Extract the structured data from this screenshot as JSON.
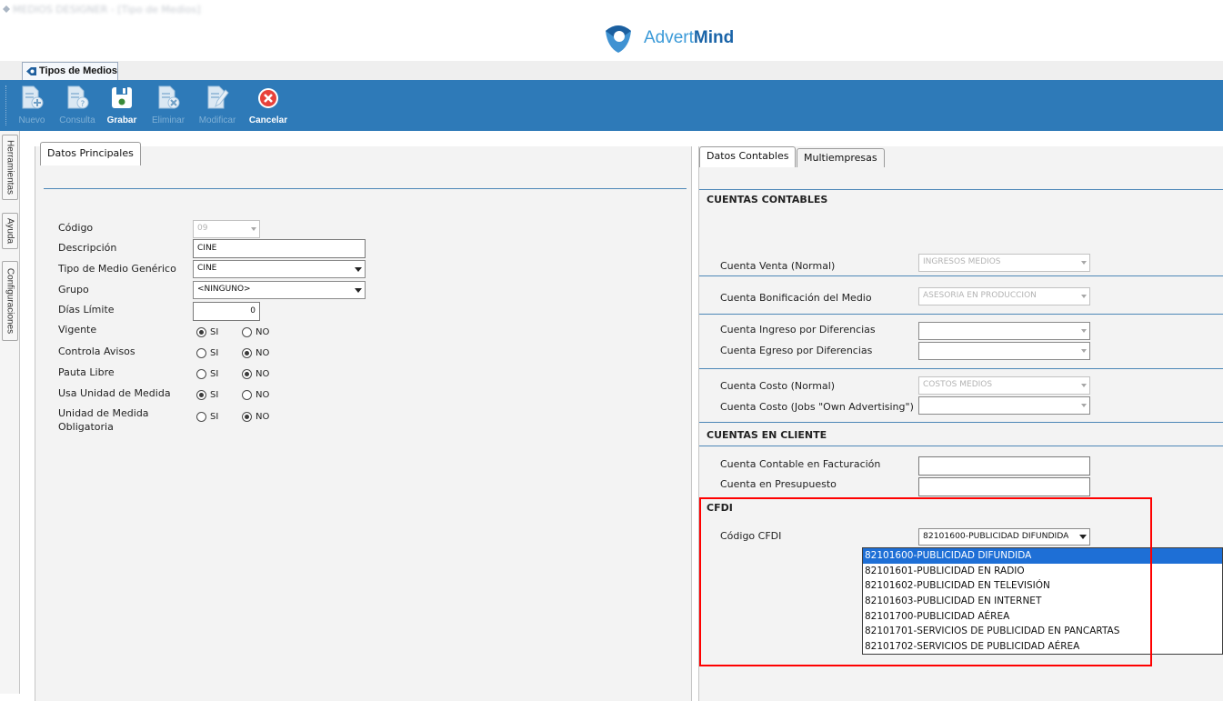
{
  "brand": {
    "prefix": "Advert",
    "strong": "Mind"
  },
  "doc_tab": {
    "label": "Tipos de Medios"
  },
  "toolbar": {
    "buttons": [
      {
        "id": "nuevo",
        "label": "Nuevo",
        "enabled": false,
        "icon": "new-document-icon"
      },
      {
        "id": "consulta",
        "label": "Consulta",
        "enabled": false,
        "icon": "query-document-icon"
      },
      {
        "id": "grabar",
        "label": "Grabar",
        "enabled": true,
        "icon": "save-icon"
      },
      {
        "id": "eliminar",
        "label": "Eliminar",
        "enabled": false,
        "icon": "delete-document-icon"
      },
      {
        "id": "modificar",
        "label": "Modificar",
        "enabled": false,
        "icon": "edit-document-icon"
      },
      {
        "id": "cancelar",
        "label": "Cancelar",
        "enabled": true,
        "icon": "cancel-icon"
      }
    ]
  },
  "side_tabs": [
    "Herramientas",
    "Ayuda",
    "Configuraciones"
  ],
  "left": {
    "tab": "Datos Principales",
    "fields": {
      "codigo": {
        "label": "Código",
        "value": "09"
      },
      "descripcion": {
        "label": "Descripción",
        "value": "CINE"
      },
      "tipo_generico": {
        "label": "Tipo de Medio Genérico",
        "value": "CINE"
      },
      "grupo": {
        "label": "Grupo",
        "value": "<NINGUNO>"
      },
      "dias_limite": {
        "label": "Días Límite",
        "value": "0"
      },
      "vigente": {
        "label": "Vigente",
        "value": "SI"
      },
      "controla_avisos": {
        "label": "Controla Avisos",
        "value": "NO"
      },
      "pauta_libre": {
        "label": "Pauta Libre",
        "value": "NO"
      },
      "usa_unidad": {
        "label": "Usa Unidad de Medida",
        "value": "SI"
      },
      "unidad_obligatoria": {
        "label_1": "Unidad de Medida",
        "label_2": "Obligatoria",
        "value": "NO"
      }
    },
    "radio_si": "SI",
    "radio_no": "NO"
  },
  "right": {
    "tabs": [
      "Datos Contables",
      "Multiempresas"
    ],
    "cuentas_contables": {
      "title": "CUENTAS CONTABLES",
      "venta_normal": {
        "label": "Cuenta Venta (Normal)",
        "value": "INGRESOS MEDIOS"
      },
      "bonificacion": {
        "label": "Cuenta Bonificación del Medio",
        "value": "ASESORIA EN PRODUCCION"
      },
      "ingreso_dif": {
        "label": "Cuenta Ingreso por Diferencias",
        "value": ""
      },
      "egreso_dif": {
        "label": "Cuenta Egreso por Diferencias",
        "value": ""
      },
      "costo_normal": {
        "label": "Cuenta Costo (Normal)",
        "value": "COSTOS MEDIOS"
      },
      "costo_jobs": {
        "label": "Cuenta Costo (Jobs \"Own Advertising\")",
        "value": ""
      }
    },
    "cuentas_cliente": {
      "title": "CUENTAS EN CLIENTE",
      "facturacion": {
        "label": "Cuenta Contable en Facturación",
        "value": ""
      },
      "presupuesto": {
        "label": "Cuenta en Presupuesto",
        "value": ""
      }
    },
    "cfdi": {
      "title": "CFDI",
      "label": "Código CFDI",
      "value": "82101600-PUBLICIDAD DIFUNDIDA",
      "options": [
        "82101600-PUBLICIDAD DIFUNDIDA",
        "82101601-PUBLICIDAD EN RADIO",
        "82101602-PUBLICIDAD EN TELEVISIÓN",
        "82101603-PUBLICIDAD EN INTERNET",
        "82101700-PUBLICIDAD AÉREA",
        "82101701-SERVICIOS DE PUBLICIDAD EN PANCARTAS",
        "82101702-SERVICIOS DE PUBLICIDAD AÉREA"
      ],
      "selected_index": 0
    }
  },
  "colors": {
    "toolbar": "#2e7ab8",
    "highlight": "#ff0000",
    "selection": "#1e6fd6"
  }
}
